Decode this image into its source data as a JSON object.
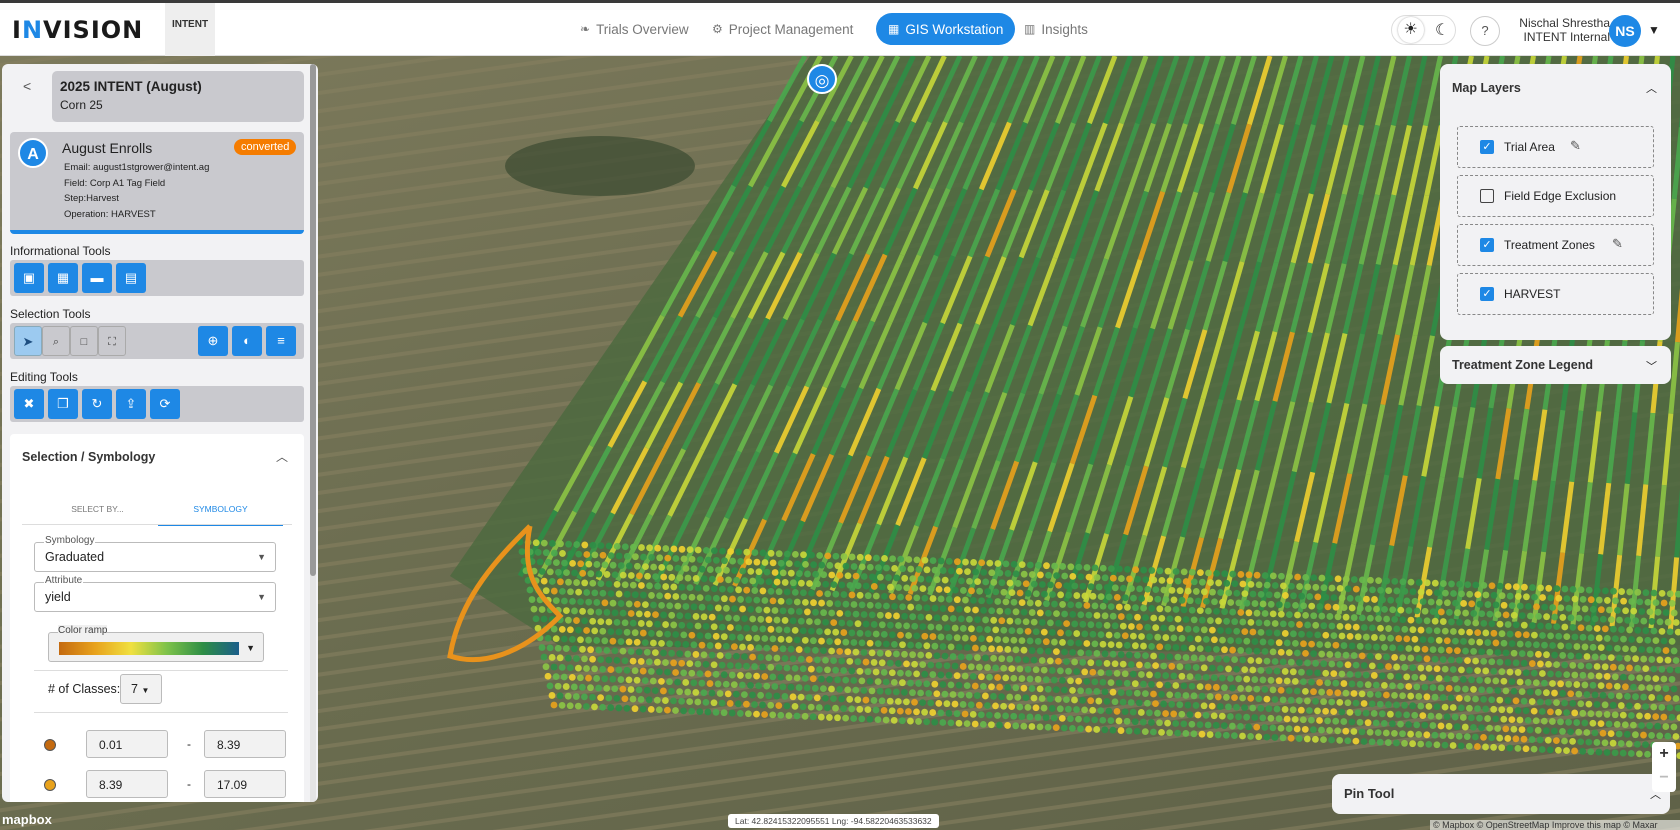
{
  "brand": {
    "logo_prefix": "I",
    "logo_accent": "N",
    "logo_rest": "VISION",
    "partner_logo": "INTENT",
    "accent": "#1e88e5"
  },
  "nav": [
    {
      "label": "Trials Overview",
      "icon": "leaf-icon"
    },
    {
      "label": "Project Management",
      "icon": "gear-icon"
    },
    {
      "label": "GIS Workstation",
      "icon": "grid-icon",
      "active": true
    },
    {
      "label": "Insights",
      "icon": "chart-icon"
    }
  ],
  "user": {
    "name": "Nischal Shrestha",
    "org": "INTENT Internal",
    "initials": "NS"
  },
  "help": "?",
  "trial": {
    "title": "2025 INTENT (August)",
    "subtitle": "Corn 25"
  },
  "enrollment": {
    "initial": "A",
    "name": "August Enrolls",
    "status": "converted",
    "status_color": "#f57c00",
    "email": "Email: august1stgrower@intent.ag",
    "field": "Field: Corp A1 Tag Field",
    "step": "Step:Harvest",
    "operation": "Operation: HARVEST"
  },
  "tools": {
    "informational": "Informational Tools",
    "selection": "Selection Tools",
    "editing": "Editing Tools"
  },
  "symbology": {
    "header": "Selection / Symbology",
    "tabs": [
      "SELECT BY...",
      "SYMBOLOGY"
    ],
    "symbology_label": "Symbology",
    "symbology_value": "Graduated",
    "attribute_label": "Attribute",
    "attribute_value": "yield",
    "ramp_label": "Color ramp",
    "classes_label": "# of Classes:",
    "classes_value": "7",
    "classes": [
      {
        "min": "0.01",
        "max": "8.39",
        "color": "#c46a10"
      },
      {
        "min": "8.39",
        "max": "17.09",
        "color": "#e8a21c"
      }
    ],
    "dash": "-"
  },
  "layers": {
    "header": "Map Layers",
    "items": [
      {
        "name": "Trial Area",
        "checked": true,
        "editable": true
      },
      {
        "name": "Field Edge Exclusion",
        "checked": false,
        "editable": false
      },
      {
        "name": "Treatment Zones",
        "checked": true,
        "editable": true
      },
      {
        "name": "HARVEST",
        "checked": true,
        "editable": false
      }
    ]
  },
  "legend": {
    "header": "Treatment Zone Legend"
  },
  "pin": {
    "header": "Pin Tool"
  },
  "map": {
    "coords": "Lat: 42.82415322095551 Lng: -94.58220463533632",
    "brand": "mapbox",
    "attribution": "© Mapbox © OpenStreetMap Improve this map © Maxar"
  },
  "zoom": {
    "in": "+",
    "out": "−"
  }
}
